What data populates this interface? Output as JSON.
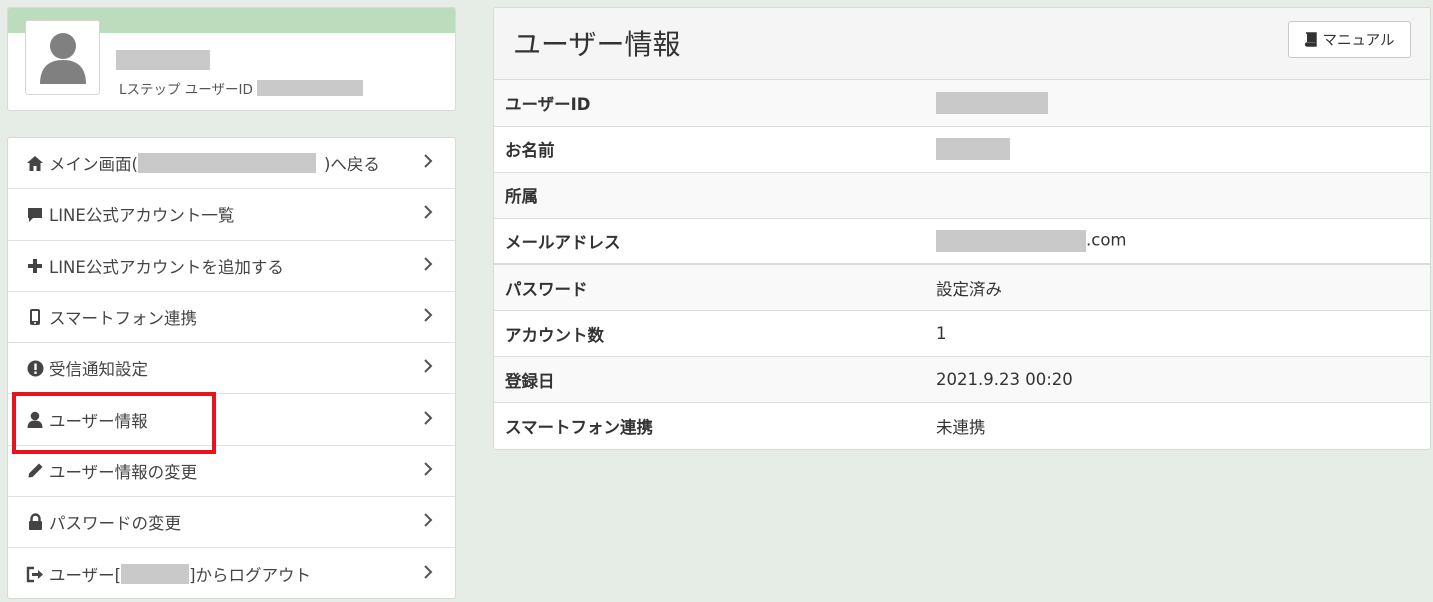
{
  "profile": {
    "id_label": "Lステップ ユーザーID"
  },
  "menu": {
    "items": [
      {
        "label_before": "メイン画面(",
        "label_after": ")へ戻る",
        "icon": "home-icon"
      },
      {
        "label": "LINE公式アカウント一覧",
        "icon": "comment-icon"
      },
      {
        "label": "LINE公式アカウントを追加する",
        "icon": "plus-icon"
      },
      {
        "label": "スマートフォン連携",
        "icon": "phone-icon"
      },
      {
        "label": "受信通知設定",
        "icon": "exclamation-icon"
      },
      {
        "label": "ユーザー情報",
        "icon": "user-icon"
      },
      {
        "label": "ユーザー情報の変更",
        "icon": "pencil-icon"
      },
      {
        "label": "パスワードの変更",
        "icon": "lock-icon"
      },
      {
        "label_before": "ユーザー[",
        "label_after": "]からログアウト",
        "icon": "logout-icon"
      }
    ]
  },
  "panel": {
    "title": "ユーザー情報",
    "manual_label": "マニュアル",
    "rows": [
      {
        "label": "ユーザーID",
        "value": ""
      },
      {
        "label": "お名前",
        "value": ""
      },
      {
        "label": "所属",
        "value": ""
      },
      {
        "label": "メールアドレス",
        "value": ".com"
      },
      {
        "label": "パスワード",
        "value": "設定済み"
      },
      {
        "label": "アカウント数",
        "value": "1"
      },
      {
        "label": "登録日",
        "value": "2021.9.23 00:20"
      },
      {
        "label": "スマートフォン連携",
        "value": "未連携"
      }
    ]
  },
  "colors": {
    "background": "#e5ede6",
    "header_strip": "#bcdcbd",
    "highlight_box": "#e8141c"
  }
}
